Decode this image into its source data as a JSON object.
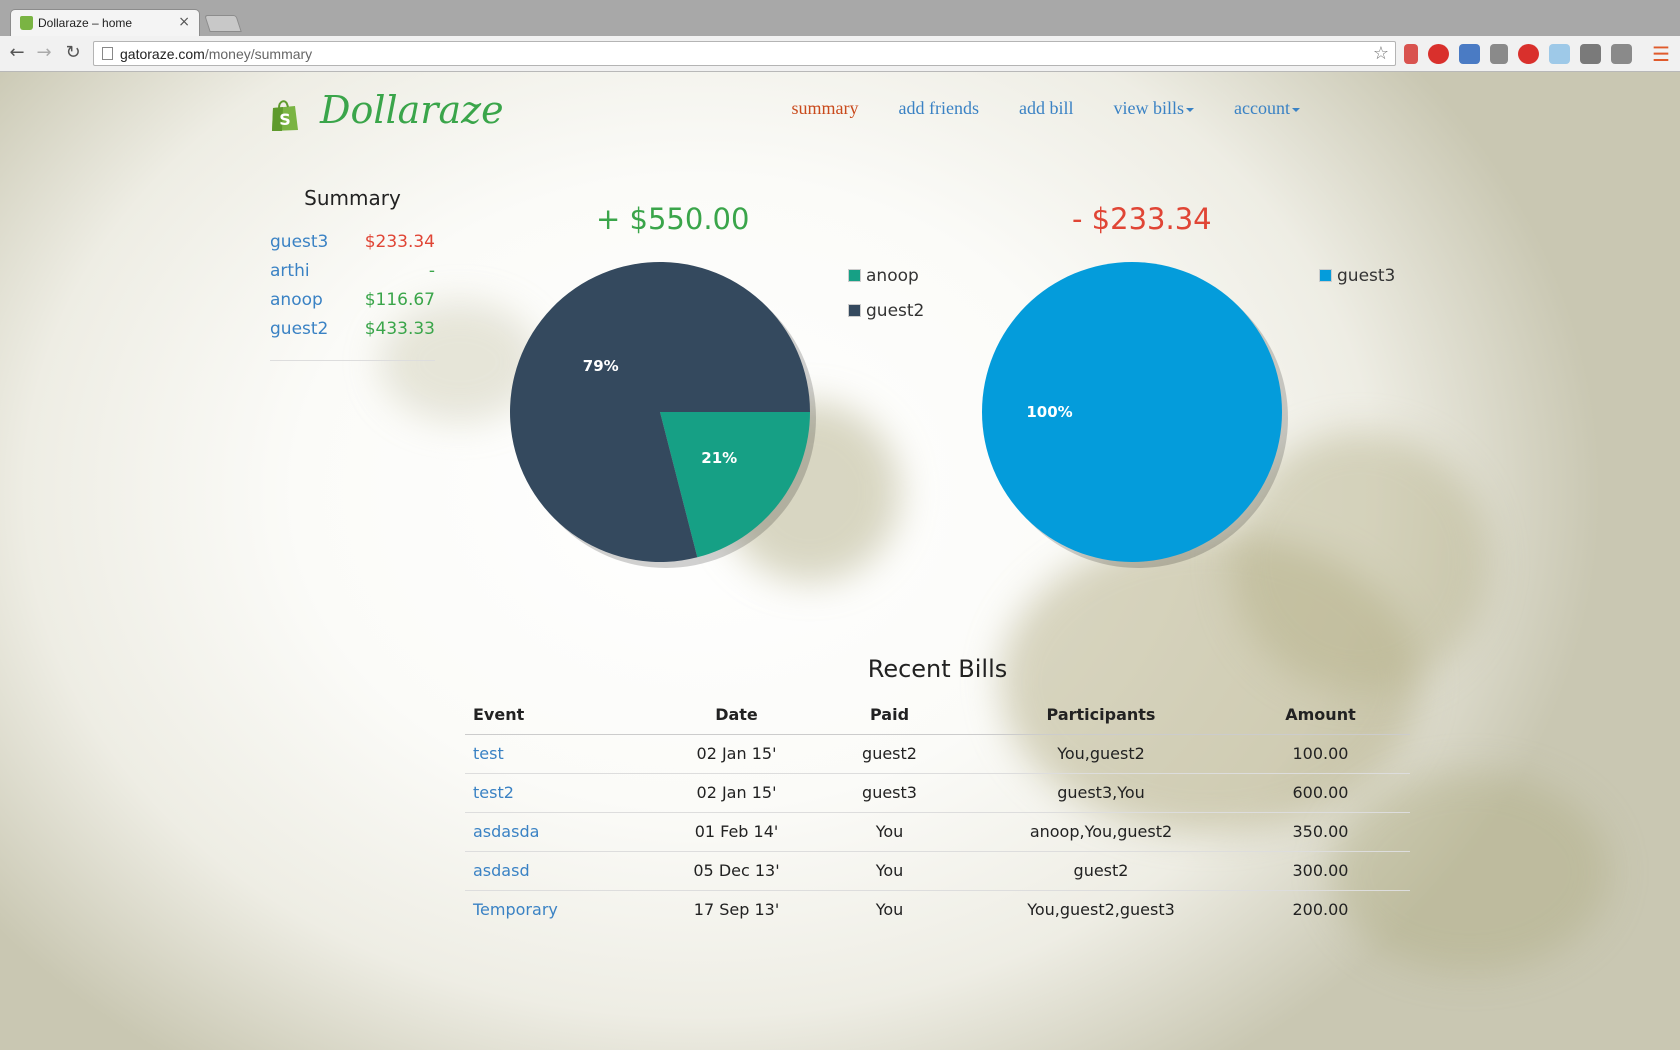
{
  "browser": {
    "tab_title": "Dollaraze – home",
    "url_host": "gatoraze.com",
    "url_path": "/money/summary"
  },
  "brand": {
    "name": "Dollaraze",
    "color": "#3aa54a"
  },
  "nav": {
    "items": [
      {
        "label": "summary",
        "active": true
      },
      {
        "label": "add friends"
      },
      {
        "label": "add bill"
      },
      {
        "label": "view bills",
        "dropdown": true
      },
      {
        "label": "account",
        "dropdown": true
      }
    ]
  },
  "summary": {
    "title": "Summary",
    "rows": [
      {
        "name": "guest3",
        "amount": "$233.34",
        "status": "negative"
      },
      {
        "name": "arthi",
        "amount": "-",
        "status": "positive"
      },
      {
        "name": "anoop",
        "amount": "$116.67",
        "status": "positive"
      },
      {
        "name": "guest2",
        "amount": "$433.33",
        "status": "positive"
      }
    ]
  },
  "chart_data": [
    {
      "type": "pie",
      "title": "+ $550.00",
      "title_color": "#3aa54a",
      "series": [
        {
          "name": "anoop",
          "value": 21,
          "color": "#16a085"
        },
        {
          "name": "guest2",
          "value": 79,
          "color": "#34495e"
        }
      ],
      "slice_labels": [
        "21%",
        "79%"
      ],
      "legend": [
        "anoop",
        "guest2"
      ],
      "legend_position": "right"
    },
    {
      "type": "pie",
      "title": "- $233.34",
      "title_color": "#e04535",
      "series": [
        {
          "name": "guest3",
          "value": 100,
          "color": "#049cdb"
        }
      ],
      "slice_labels": [
        "100%"
      ],
      "legend": [
        "guest3"
      ],
      "legend_position": "top-right"
    }
  ],
  "recent_bills": {
    "title": "Recent Bills",
    "columns": [
      "Event",
      "Date",
      "Paid",
      "Participants",
      "Amount"
    ],
    "rows": [
      [
        "test",
        "02 Jan 15'",
        "guest2",
        "You,guest2",
        "100.00"
      ],
      [
        "test2",
        "02 Jan 15'",
        "guest3",
        "guest3,You",
        "600.00"
      ],
      [
        "asdasda",
        "01 Feb 14'",
        "You",
        "anoop,You,guest2",
        "350.00"
      ],
      [
        "asdasd",
        "05 Dec 13'",
        "You",
        "guest2",
        "300.00"
      ],
      [
        "Temporary",
        "17 Sep 13'",
        "You",
        "You,guest2,guest3",
        "200.00"
      ]
    ]
  }
}
